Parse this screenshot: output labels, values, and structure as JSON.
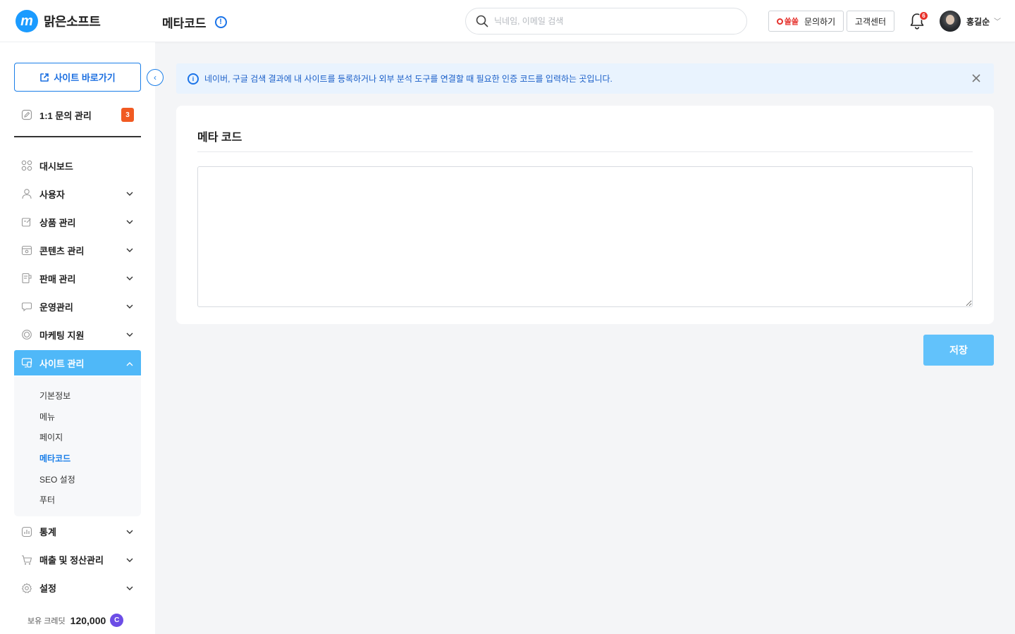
{
  "header": {
    "logo_text": "맑은소프트",
    "page_title": "메타코드",
    "search_placeholder": "닉네임, 이메일 검색",
    "inquiry_brand": "쏠쏠",
    "inquiry_label": "문의하기",
    "support_label": "고객센터",
    "notification_count": "6",
    "username": "홍길순"
  },
  "sidebar": {
    "site_button_label": "사이트 바로가기",
    "inquiry": {
      "label": "1:1 문의 관리",
      "badge": "3"
    },
    "nav": [
      {
        "label": "대시보드",
        "icon": "grid-icon",
        "expandable": false
      },
      {
        "label": "사용자",
        "icon": "user-icon",
        "expandable": true
      },
      {
        "label": "상품 관리",
        "icon": "edit-box-icon",
        "expandable": true
      },
      {
        "label": "콘텐츠 관리",
        "icon": "calendar-icon",
        "expandable": true
      },
      {
        "label": "판매 관리",
        "icon": "receipt-icon",
        "expandable": true
      },
      {
        "label": "운영관리",
        "icon": "chat-icon",
        "expandable": true
      },
      {
        "label": "마케팅 지원",
        "icon": "target-icon",
        "expandable": true
      },
      {
        "label": "사이트 관리",
        "icon": "monitor-icon",
        "expandable": true,
        "active": true
      },
      {
        "label": "통계",
        "icon": "chart-icon",
        "expandable": true
      },
      {
        "label": "매출 및 정산관리",
        "icon": "cart-icon",
        "expandable": true
      },
      {
        "label": "설정",
        "icon": "settings-icon",
        "expandable": true
      }
    ],
    "submenu": [
      "기본정보",
      "메뉴",
      "페이지",
      "메타코드",
      "SEO 설정",
      "푸터"
    ],
    "submenu_current": "메타코드",
    "credit": {
      "label": "보유 크레딧",
      "amount": "120,000",
      "icon_letter": "C"
    }
  },
  "main": {
    "notice_text": "네이버, 구글 검색 결과에 내 사이트를 등록하거나 외부 분석 도구를 연결할 때 필요한 인증 코드를 입력하는 곳입니다.",
    "card_title": "메타 코드",
    "textarea_value": "",
    "save_label": "저장"
  },
  "colors": {
    "accent": "#1a7ee8",
    "active_nav": "#4fb8f8",
    "save_button": "#62c2fb",
    "badge_orange": "#f15a22",
    "notice_bg": "#e9f3fe"
  }
}
